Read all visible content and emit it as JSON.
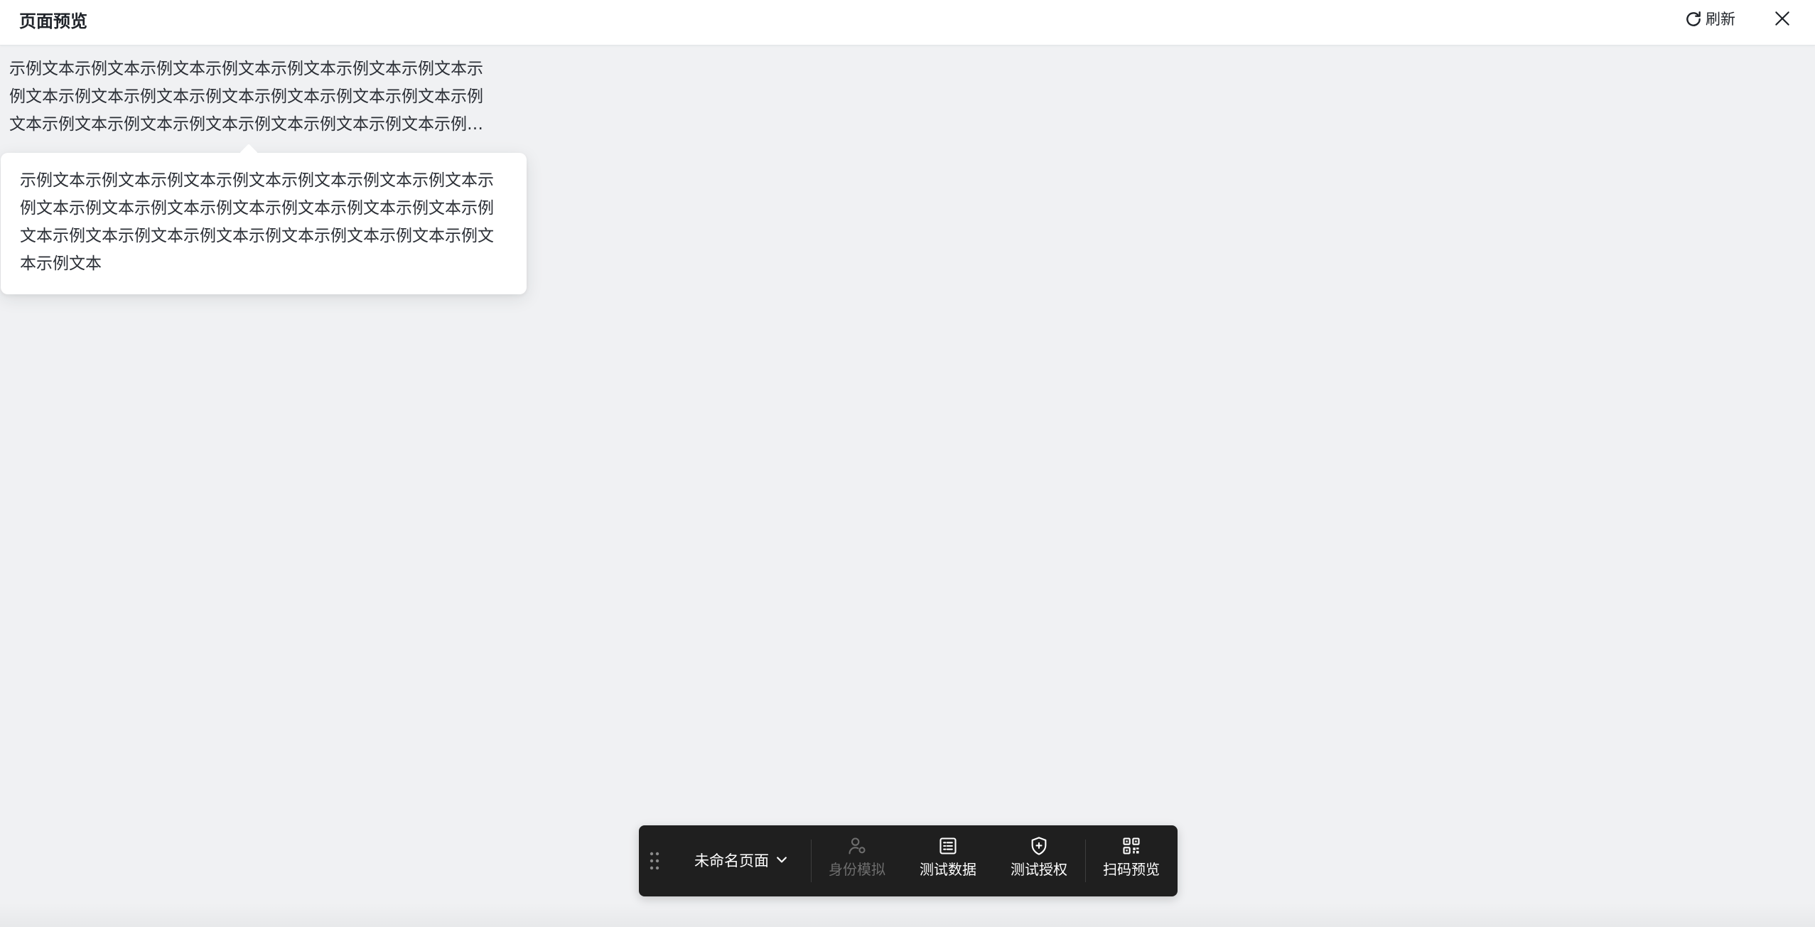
{
  "header": {
    "title": "页面预览",
    "refresh_label": "刷新"
  },
  "content": {
    "truncated_text": "示例文本示例文本示例文本示例文本示例文本示例文本示例文本示例文本示例文本示例文本示例文本示例文本示例文本示例文本示例文本示例文本示例文本示例文本示例文本示例文本示例文本示例文本示例文本",
    "tooltip_text": "示例文本示例文本示例文本示例文本示例文本示例文本示例文本示例文本示例文本示例文本示例文本示例文本示例文本示例文本示例文本示例文本示例文本示例文本示例文本示例文本示例文本示例文本示例文本"
  },
  "toolbar": {
    "page_select": "未命名页面",
    "buttons": [
      {
        "label": "身份模拟",
        "icon": "user-settings-icon",
        "disabled": true
      },
      {
        "label": "测试数据",
        "icon": "data-list-icon",
        "disabled": false
      },
      {
        "label": "测试授权",
        "icon": "shield-plus-icon",
        "disabled": false
      },
      {
        "label": "扫码预览",
        "icon": "qr-code-icon",
        "disabled": false
      }
    ]
  }
}
